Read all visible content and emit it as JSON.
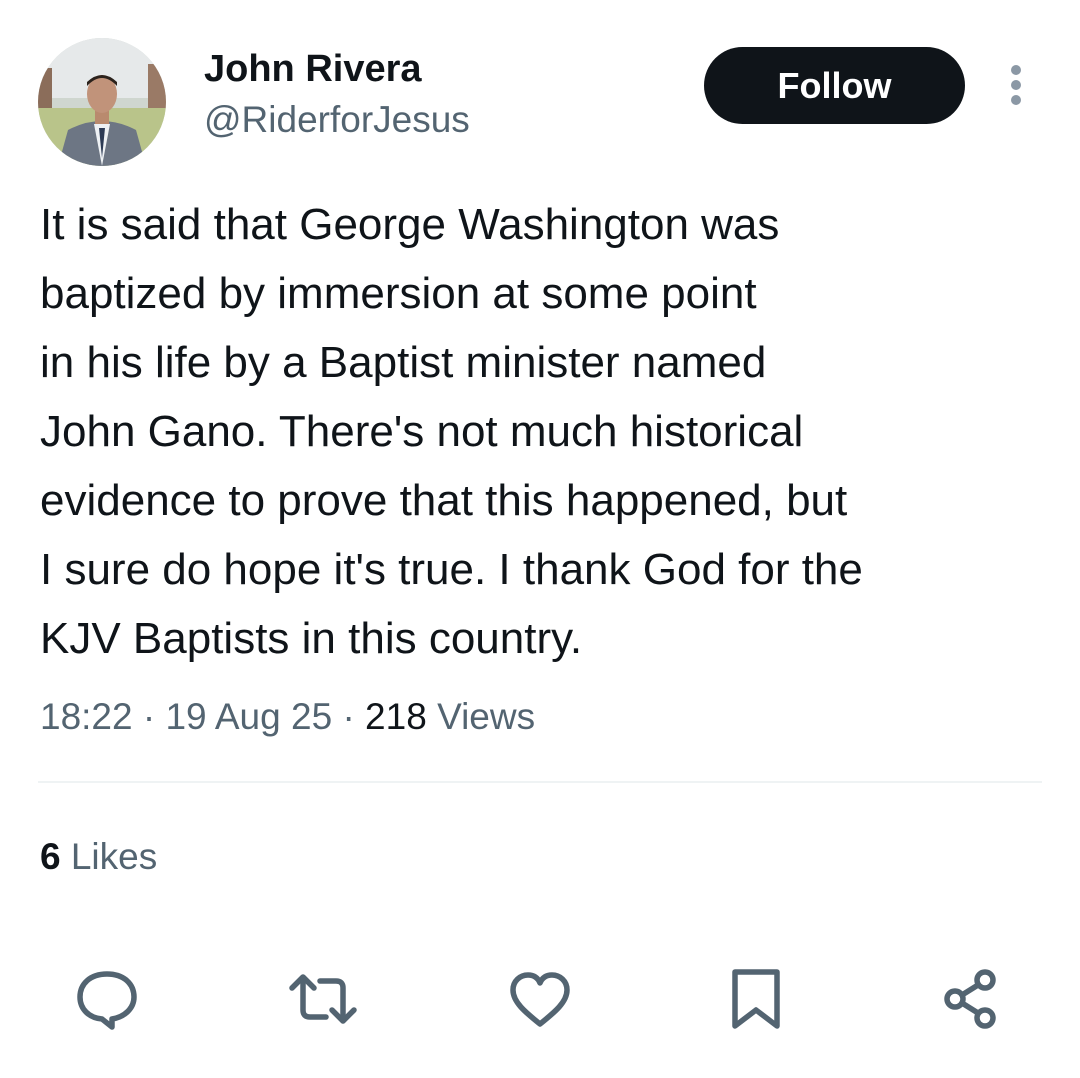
{
  "author": {
    "display_name": "John Rivera",
    "handle": "@RiderforJesus",
    "avatar_icon": "profile-photo"
  },
  "follow_button_label": "Follow",
  "more_icon": "more-vertical-icon",
  "tweet": {
    "lines": [
      "It is said that George Washington was",
      "baptized by immersion at some point",
      "in his life by a Baptist minister named",
      "John Gano. There's not much historical",
      "evidence to prove that this happened, but",
      "I sure do hope it's true. I thank God for the",
      "KJV Baptists in this country."
    ]
  },
  "meta": {
    "time": "18:22",
    "separator": "·",
    "date": "19 Aug 25",
    "views_count": "218",
    "views_label": "Views"
  },
  "likes": {
    "count": "6",
    "label": "Likes"
  },
  "actions": {
    "reply_icon": "reply-icon",
    "repost_icon": "repost-icon",
    "like_icon": "heart-icon",
    "bookmark_icon": "bookmark-icon",
    "share_icon": "share-icon"
  },
  "colors": {
    "primary_text": "#0f1419",
    "secondary_text": "#536471",
    "follow_bg": "#0f1419",
    "divider": "#eff3f4"
  }
}
